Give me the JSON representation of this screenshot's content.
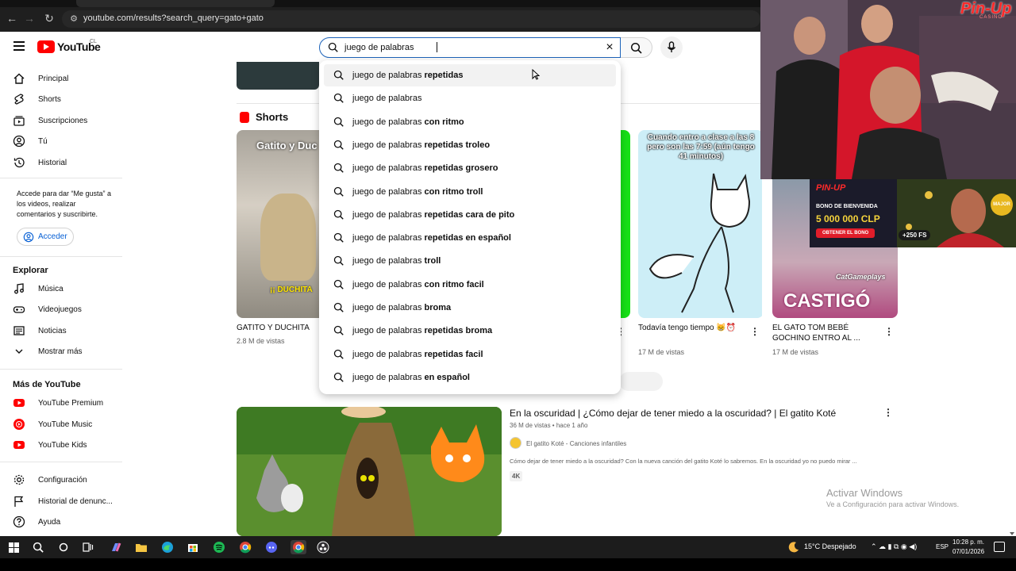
{
  "browser": {
    "url": "youtube.com/results?search_query=gato+gato"
  },
  "header": {
    "logo_text": "YouTube",
    "country_code": "CL",
    "search_value": "juego de palabras"
  },
  "sidebar": {
    "items": [
      {
        "label": "Principal",
        "icon": "home-icon"
      },
      {
        "label": "Shorts",
        "icon": "shorts-icon"
      },
      {
        "label": "Suscripciones",
        "icon": "subscriptions-icon"
      },
      {
        "label": "Tú",
        "icon": "you-icon"
      },
      {
        "label": "Historial",
        "icon": "history-icon"
      }
    ],
    "signin_note": "Accede para dar “Me gusta” a los videos, realizar comentarios y suscribirte.",
    "signin_label": "Acceder",
    "explore_heading": "Explorar",
    "explore": [
      {
        "label": "Música",
        "icon": "music-icon"
      },
      {
        "label": "Videojuegos",
        "icon": "gaming-icon"
      },
      {
        "label": "Noticias",
        "icon": "news-icon"
      },
      {
        "label": "Mostrar más",
        "icon": "chevron-down-icon"
      }
    ],
    "more_heading": "Más de YouTube",
    "more": [
      {
        "label": "YouTube Premium"
      },
      {
        "label": "YouTube Music"
      },
      {
        "label": "YouTube Kids"
      }
    ],
    "settings": [
      {
        "label": "Configuración",
        "icon": "gear-icon"
      },
      {
        "label": "Historial de denunc...",
        "icon": "flag-icon"
      },
      {
        "label": "Ayuda",
        "icon": "help-icon"
      }
    ]
  },
  "shorts": {
    "heading": "Shorts",
    "cards": [
      {
        "title": "GATITO Y DUCHITA",
        "views": "2.8 M de vistas",
        "overlay": "Gatito y Duc",
        "caption": "¡¡ DUCHITA"
      },
      {
        "title": "Todavía tengo tiempo 😸⏰",
        "views": "17 M de vistas",
        "overlay": "Cuando entro a clase a las 8 pero son las 7:59 (aún tengo 41 minutos)"
      },
      {
        "title": "EL GATO TOM BEBÉ GOCHINO  ENTRO AL ...",
        "views": "17 M de vistas",
        "overlay": "CatGameplays",
        "caption": "CASTIGÓ"
      }
    ]
  },
  "suggestions": [
    {
      "prefix": "juego de palabras",
      "suffix": "repetidas"
    },
    {
      "prefix": "juego de palabras",
      "suffix": ""
    },
    {
      "prefix": "juego de palabras",
      "suffix": "con ritmo"
    },
    {
      "prefix": "juego de palabras",
      "suffix": "repetidas troleo"
    },
    {
      "prefix": "juego de palabras",
      "suffix": "repetidas grosero"
    },
    {
      "prefix": "juego de palabras",
      "suffix": "con ritmo troll"
    },
    {
      "prefix": "juego de palabras",
      "suffix": "repetidas cara de pito"
    },
    {
      "prefix": "juego de palabras",
      "suffix": "repetidas en español"
    },
    {
      "prefix": "juego de palabras",
      "suffix": "troll"
    },
    {
      "prefix": "juego de palabras",
      "suffix": "con ritmo facil"
    },
    {
      "prefix": "juego de palabras",
      "suffix": "broma"
    },
    {
      "prefix": "juego de palabras",
      "suffix": "repetidas broma"
    },
    {
      "prefix": "juego de palabras",
      "suffix": "repetidas facil"
    },
    {
      "prefix": "juego de palabras",
      "suffix": "en español"
    }
  ],
  "video": {
    "title": "En la oscuridad | ¿Cómo dejar de tener miedo a la oscuridad? | El gatito Koté",
    "meta": "36 M de vistas • hace 1 año",
    "channel": "El gatito Koté - Canciones infantiles",
    "description": "Cómo dejar de tener miedo a la oscuridad? Con la nueva canción del gatito Koté lo sabremos. En la oscuridad yo no puedo mirar ...",
    "badge": "4K"
  },
  "overlay": {
    "brand": "Pin-Up",
    "brand_sub": "CASINO",
    "ad_brand": "PIN-UP",
    "ad_line1": "BONO DE BIENVENIDA",
    "ad_amount": "5 000 000 CLP",
    "ad_cta": "OBTENER EL BONO",
    "ad_fs": "+250 FS",
    "ad_badge": "MAJOR"
  },
  "windows": {
    "activate_title": "Activar Windows",
    "activate_sub": "Ve a Configuración para activar Windows."
  },
  "taskbar": {
    "weather": "15°C  Despejado",
    "lang": "ESP",
    "time": "10:28 p. m.",
    "date": "07/01/2026"
  },
  "colors": {
    "accent": "#065fd4",
    "youtube_red": "#ff0000",
    "focus_border": "#1c62b9"
  }
}
